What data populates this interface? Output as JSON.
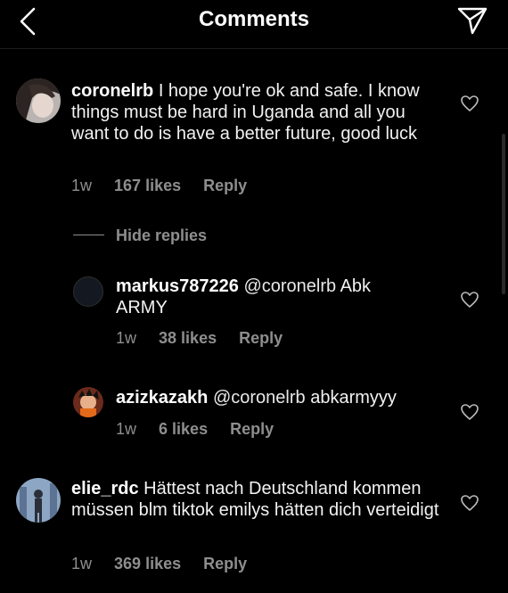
{
  "header": {
    "title": "Comments",
    "back_icon": "chevron-left-icon",
    "send_icon": "paper-plane-icon"
  },
  "comments": [
    {
      "username": "coronelrb",
      "text": "I hope you're ok and safe. I know things must be hard in Uganda and all you want to do is have a better future, good luck",
      "time": "1w",
      "likes": "167 likes",
      "reply": "Reply"
    },
    {
      "hide_replies": "Hide replies",
      "replies": [
        {
          "username": "markus787226",
          "mention": "@coronelrb",
          "text": "Abk ARMY",
          "time": "1w",
          "likes": "38 likes",
          "reply": "Reply"
        },
        {
          "username": "azizkazakh",
          "mention": "@coronelrb",
          "text": "abkarmyyy",
          "time": "1w",
          "likes": "6 likes",
          "reply": "Reply"
        }
      ]
    },
    {
      "username": "elie_rdc",
      "text": "Hättest nach Deutschland kommen müssen blm tiktok emilys hätten dich verteidigt",
      "time": "1w",
      "likes": "369 likes",
      "reply": "Reply"
    }
  ],
  "colors": {
    "background": "#000000",
    "text": "#f2f2f2",
    "muted": "#8e8e8e"
  }
}
